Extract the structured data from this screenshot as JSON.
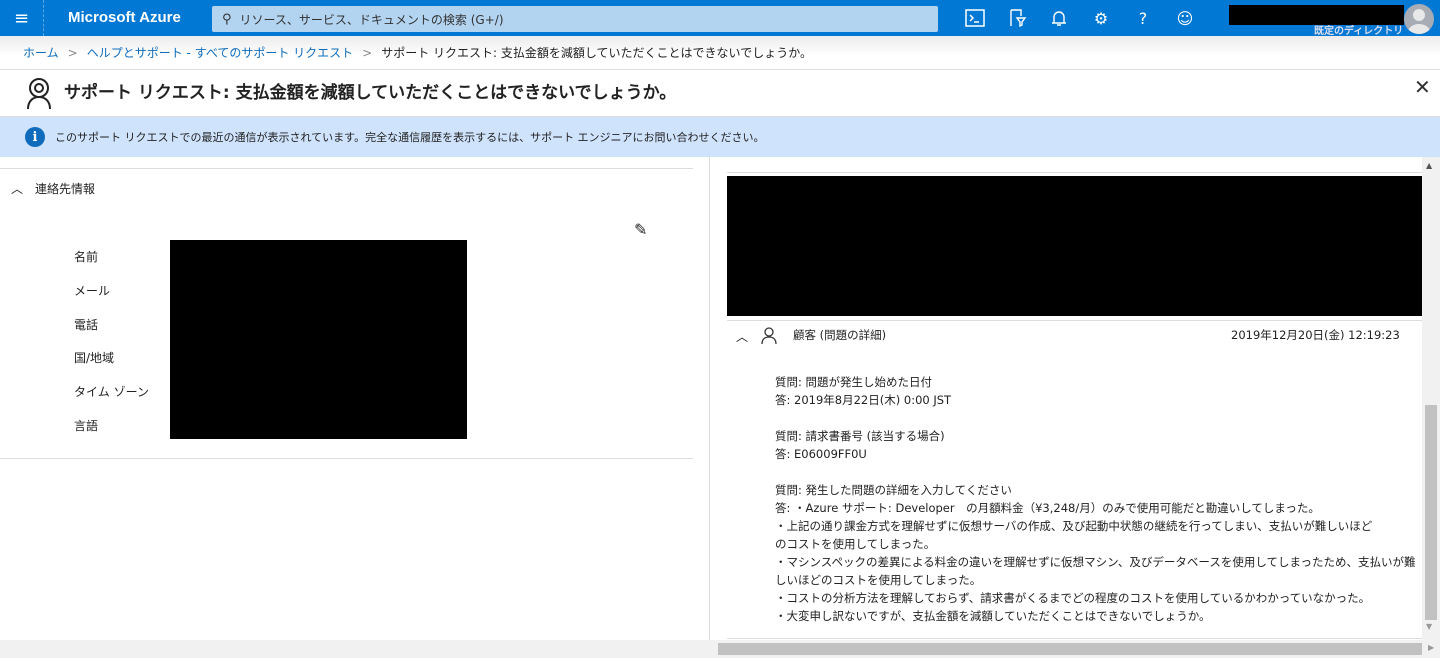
{
  "topbar": {
    "brand": "Microsoft Azure",
    "search_placeholder": "リソース、サービス、ドキュメントの検索 (G+/)",
    "directory": "既定のディレクトリ"
  },
  "breadcrumb": [
    "ホーム",
    "ヘルプとサポート - すべてのサポート リクエスト",
    "サポート リクエスト: 支払金額を減額していただくことはできないでしょうか。"
  ],
  "title": "サポート リクエスト: 支払金額を減額していただくことはできないでしょうか。",
  "info": "このサポート リクエストでの最近の通信が表示されています。完全な通信履歴を表示するには、サポート エンジニアにお問い合わせください。",
  "contact": {
    "header": "連絡先情報",
    "labels": [
      "名前",
      "メール",
      "電話",
      "国/地域",
      "タイム ゾーン",
      "言語"
    ]
  },
  "message": {
    "author": "顧客 (問題の詳細)",
    "timestamp": "2019年12月20日(金) 12:19:23",
    "lines": [
      "質問: 問題が発生し始めた日付",
      "答: 2019年8月22日(木) 0:00 JST",
      "",
      "質問: 請求書番号 (該当する場合)",
      "答: E06009FF0U",
      "",
      "質問: 発生した問題の詳細を入力してください",
      "答: ・Azure サポート: Developer　の月額料金（¥3,248/月）のみで使用可能だと勘違いしてしまった。",
      "・上記の通り課金方式を理解せずに仮想サーバの作成、及び起動中状態の継続を行ってしまい、支払いが難しいほど",
      "のコストを使用してしまった。",
      "・マシンスペックの差異による料金の違いを理解せずに仮想マシン、及びデータベースを使用してしまったため、支払いが難",
      "しいほどのコストを使用してしまった。",
      "・コストの分析方法を理解しておらず、請求書がくるまでどの程度のコストを使用しているかわかっていなかった。",
      "・大変申し訳ないですが、支払金額を減額していただくことはできないでしょうか。"
    ]
  }
}
